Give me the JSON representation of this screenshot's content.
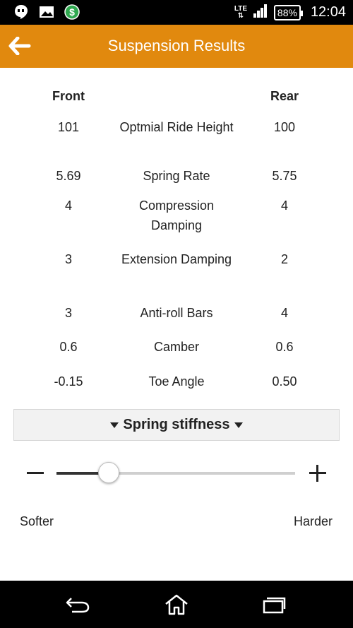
{
  "status_bar": {
    "network": "LTE",
    "battery": "88%",
    "time": "12:04",
    "icons": [
      "hangouts-icon",
      "image-icon",
      "dollar-app-icon",
      "lte-icon",
      "signal-icon",
      "battery-icon"
    ]
  },
  "app_bar": {
    "title": "Suspension Results",
    "background": "#e1890e",
    "back_icon": "arrow-left-icon"
  },
  "results": {
    "headers": {
      "front": "Front",
      "rear": "Rear"
    },
    "rows": [
      {
        "front": "101",
        "label": "Optmial Ride Height",
        "rear": "100"
      },
      {
        "front": "5.69",
        "label": "Spring Rate",
        "rear": "5.75"
      },
      {
        "front": "4",
        "label": "Compression Damping",
        "rear": "4"
      },
      {
        "front": "3",
        "label": "Extension Damping",
        "rear": "2"
      },
      {
        "front": "3",
        "label": "Anti-roll Bars",
        "rear": "4"
      },
      {
        "front": "0.6",
        "label": "Camber",
        "rear": "0.6"
      },
      {
        "front": "-0.15",
        "label": "Toe Angle",
        "rear": "0.50"
      }
    ]
  },
  "dropdown": {
    "label": "Spring stiffness"
  },
  "slider": {
    "value_fraction": 0.22,
    "left_label": "Softer",
    "right_label": "Harder"
  },
  "nav_bar": {
    "icons": [
      "back-icon",
      "home-icon",
      "recents-icon"
    ]
  }
}
